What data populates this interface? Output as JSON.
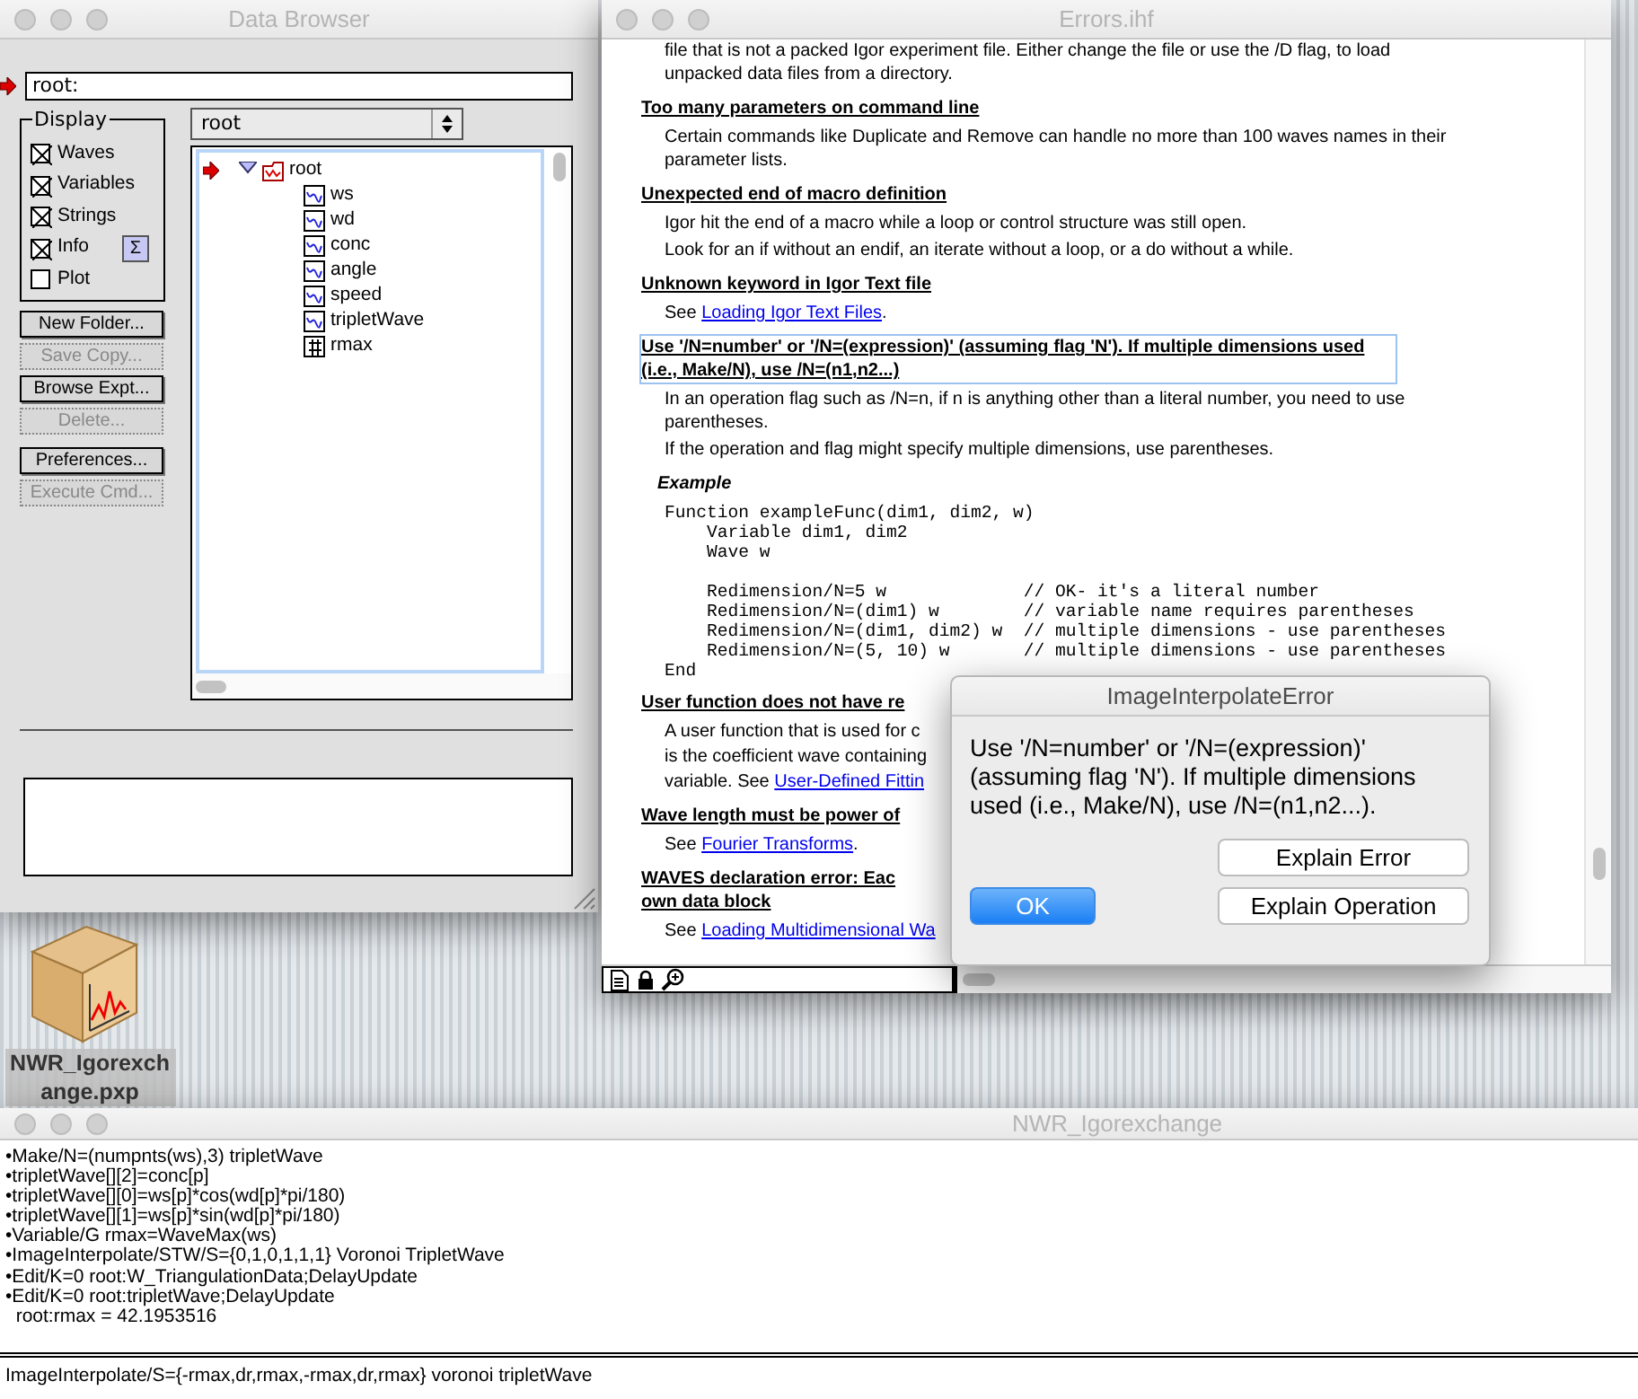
{
  "data_browser": {
    "title": "Data Browser",
    "path_field": "root:",
    "display_group": {
      "title": "Display",
      "options": [
        {
          "label": "Waves",
          "checked": true
        },
        {
          "label": "Variables",
          "checked": true
        },
        {
          "label": "Strings",
          "checked": true
        },
        {
          "label": "Info",
          "checked": true
        },
        {
          "label": "Plot",
          "checked": false
        }
      ]
    },
    "sum_button": "Σ",
    "buttons": [
      {
        "label": "New Folder...",
        "disabled": false
      },
      {
        "label": "Save Copy...",
        "disabled": true
      },
      {
        "label": "Browse Expt...",
        "disabled": false
      },
      {
        "label": "Delete...",
        "disabled": true
      },
      {
        "label": "Preferences...",
        "disabled": false
      },
      {
        "label": "Execute Cmd...",
        "disabled": true
      }
    ],
    "folder_popup": "root",
    "tree": [
      {
        "label": "root",
        "kind": "folder",
        "current": true,
        "expanded": true,
        "children": [
          {
            "label": "ws",
            "kind": "wave"
          },
          {
            "label": "wd",
            "kind": "wave"
          },
          {
            "label": "conc",
            "kind": "wave"
          },
          {
            "label": "angle",
            "kind": "wave"
          },
          {
            "label": "speed",
            "kind": "wave"
          },
          {
            "label": "tripletWave",
            "kind": "wave"
          },
          {
            "label": "rmax",
            "kind": "variable"
          }
        ]
      }
    ]
  },
  "desktop_icon": {
    "label": "NWR_Igorexchange.pxp"
  },
  "errors_window": {
    "title": "Errors.ihf",
    "blocks": [
      {
        "kind": "para",
        "lines": [
          {
            "text": "file that is not a packed Igor experiment file. Either change the file or use the /D flag, to load unpacked data files from a directory."
          }
        ]
      },
      {
        "kind": "heading",
        "lines": [
          "Too many parameters on command line"
        ]
      },
      {
        "kind": "para",
        "lines": [
          {
            "text": "Certain commands like Duplicate and Remove can handle no more than 100 waves names in their parameter lists."
          }
        ]
      },
      {
        "kind": "heading",
        "lines": [
          "Unexpected end of macro definition"
        ]
      },
      {
        "kind": "para",
        "lines": [
          {
            "text": "Igor hit the end of a macro while a loop or control structure was still open."
          }
        ]
      },
      {
        "kind": "para",
        "lines": [
          {
            "text": "Look for an if without an endif, an iterate without a loop, or a do without a while."
          }
        ]
      },
      {
        "kind": "heading",
        "lines": [
          "Unknown keyword in Igor Text file"
        ]
      },
      {
        "kind": "para",
        "lines": [
          {
            "text": "See ",
            "link": "Loading Igor Text Files",
            "after": "."
          }
        ]
      },
      {
        "kind": "heading",
        "selected": true,
        "lines": [
          "Use '/N=number' or '/N=(expression)' (assuming flag 'N'). If multiple dimensions used (i.e., Make/N), use /N=(n1,n2...)"
        ]
      },
      {
        "kind": "para",
        "lines": [
          {
            "text": "In an operation flag such as /N=n, if n is anything other than a literal number, you need to use parentheses."
          }
        ]
      },
      {
        "kind": "para",
        "lines": [
          {
            "text": "If the operation and flag might specify multiple dimensions, use parentheses."
          }
        ]
      },
      {
        "kind": "label",
        "lines": [
          "Example"
        ]
      },
      {
        "kind": "code",
        "text": "Function exampleFunc(dim1, dim2, w)\n    Variable dim1, dim2\n    Wave w\n\n    Redimension/N=5 w             // OK- it's a literal number\n    Redimension/N=(dim1) w        // variable name requires parentheses\n    Redimension/N=(dim1, dim2) w  // multiple dimensions - use parentheses\n    Redimension/N=(5, 10) w       // multiple dimensions - use parentheses\nEnd"
      },
      {
        "kind": "heading",
        "lines": [
          "User function does not have re"
        ]
      },
      {
        "kind": "para",
        "lines": [
          {
            "text": "A user function that is used for c"
          },
          {
            "text": "is the coefficient wave containing"
          },
          {
            "text": "variable. See ",
            "link": "User-Defined Fittin"
          }
        ]
      },
      {
        "kind": "heading",
        "lines": [
          "Wave length must be power of"
        ]
      },
      {
        "kind": "para",
        "lines": [
          {
            "text": "See ",
            "link": "Fourier Transforms",
            "after": "."
          }
        ]
      },
      {
        "kind": "heading",
        "lines": [
          "WAVES declaration error: Eac",
          "own data block"
        ]
      },
      {
        "kind": "para",
        "lines": [
          {
            "text": "See ",
            "link": "Loading Multidimensional Wa"
          }
        ]
      }
    ]
  },
  "dialog": {
    "title": "ImageInterpolateError",
    "message": "Use '/N=number' or '/N=(expression)' (assuming flag 'N'). If multiple dimensions used (i.e., Make/N), use /N=(n1,n2...).",
    "buttons": [
      {
        "label": "Explain Error",
        "default": false
      },
      {
        "label": "OK",
        "default": true
      },
      {
        "label": "Explain Operation",
        "default": false
      }
    ]
  },
  "command_window": {
    "title": "NWR_Igorexchange",
    "history": [
      "•Make/N=(numpnts(ws),3) tripletWave",
      "•tripletWave[][2]=conc[p]",
      "•tripletWave[][0]=ws[p]*cos(wd[p]*pi/180)",
      "•tripletWave[][1]=ws[p]*sin(wd[p]*pi/180)",
      "•Variable/G rmax=WaveMax(ws)",
      "•ImageInterpolate/STW/S={0,1,0,1,1,1} Voronoi TripletWave",
      "•Edit/K=0 root:W_TriangulationData;DelayUpdate",
      "•Edit/K=0 root:tripletWave;DelayUpdate",
      "  root:rmax = 42.1953516"
    ],
    "command_line": "ImageInterpolate/S={-rmax,dr,rmax,-rmax,dr,rmax} voronoi tripletWave"
  }
}
